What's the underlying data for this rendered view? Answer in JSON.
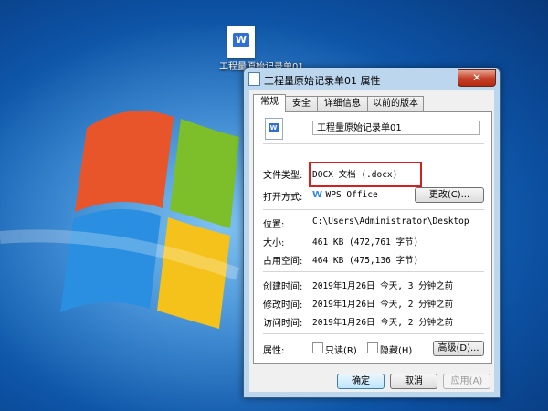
{
  "desktop": {
    "icon_label": "工程量原始记录单01"
  },
  "dialog": {
    "title": "工程量原始记录单01 属性",
    "close_glyph": "✕",
    "tabs": [
      {
        "label": "常规"
      },
      {
        "label": "安全"
      },
      {
        "label": "详细信息"
      },
      {
        "label": "以前的版本"
      }
    ],
    "file_name": "工程量原始记录单01",
    "file_type_label": "文件类型:",
    "file_type_value": "DOCX 文档 (.docx)",
    "open_with_label": "打开方式:",
    "open_with_value": "WPS Office",
    "change_button": "更改(C)...",
    "location_label": "位置:",
    "location_value": "C:\\Users\\Administrator\\Desktop",
    "size_label": "大小:",
    "size_value": "461 KB (472,761 字节)",
    "disk_size_label": "占用空间:",
    "disk_size_value": "464 KB (475,136 字节)",
    "created_label": "创建时间:",
    "created_value": "2019年1月26日 今天, 3 分钟之前",
    "modified_label": "修改时间:",
    "modified_value": "2019年1月26日 今天, 2 分钟之前",
    "accessed_label": "访问时间:",
    "accessed_value": "2019年1月26日 今天, 2 分钟之前",
    "attributes_label": "属性:",
    "readonly_label": "只读(R)",
    "hidden_label": "隐藏(H)",
    "advanced_button": "高级(D)...",
    "ok_button": "确定",
    "cancel_button": "取消",
    "apply_button": "应用(A)"
  },
  "colors": {
    "highlight_box": "#d61f1f",
    "close_button": "#c7432b"
  }
}
